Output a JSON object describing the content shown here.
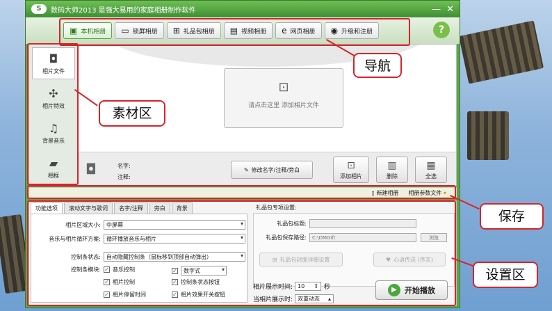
{
  "window": {
    "logo": "S",
    "title": "数码大师2013    是强大易用的家庭相册制作软件",
    "minimize": "—",
    "close": "✕"
  },
  "nav": {
    "tabs": [
      {
        "label": "本机相册",
        "icon": "photo-album-icon",
        "glyph": "▣"
      },
      {
        "label": "锁屏相册",
        "icon": "monitor-icon",
        "glyph": "▭"
      },
      {
        "label": "礼品包相册",
        "icon": "gift-icon",
        "glyph": "⊞"
      },
      {
        "label": "视频相册",
        "icon": "film-icon",
        "glyph": "▤"
      },
      {
        "label": "网页相册",
        "icon": "ie-icon",
        "glyph": "e"
      },
      {
        "label": "升级和注册",
        "icon": "globe-icon",
        "glyph": "◉"
      }
    ],
    "help": "?"
  },
  "leftbar": {
    "items": [
      {
        "label": "相片文件",
        "icon": "camera-icon",
        "glyph": "◘"
      },
      {
        "label": "相片特效",
        "icon": "effects-icon",
        "glyph": "✣"
      },
      {
        "label": "背景音乐",
        "icon": "music-icon",
        "glyph": "♫"
      },
      {
        "label": "相框",
        "icon": "frame-icon",
        "glyph": "▰"
      }
    ]
  },
  "canvas": {
    "drop_text": "请点击这里  添加相片文件",
    "drop_glyph": "⊡"
  },
  "info": {
    "name_label": "名字:",
    "note_label": "注释:",
    "edit_button": "修改名字/注释/旁白",
    "add_button": "添加相片",
    "delete_button": "删除",
    "selectall_button": "全选"
  },
  "savebar": {
    "new_album": "新建相册",
    "album_params": "相册参数文件"
  },
  "settings": {
    "tabs": [
      "功能选项",
      "滚动文字与歌词",
      "名字/注释",
      "旁白",
      "背景"
    ],
    "photo_size_label": "相片区域大小:",
    "photo_size_value": "中屏幕",
    "loop_label": "音乐与相片循环方案:",
    "loop_value": "循环播放音乐与相片",
    "ctrl_state_label": "控制条状态:",
    "ctrl_state_value": "自动隐藏控制条（鼠标移到顶部自动弹出）",
    "ctrl_module_label": "控制条模块:",
    "checks": [
      {
        "label": "音乐控制",
        "checked": true
      },
      {
        "label": "数字式",
        "checked": true,
        "is_select": true
      },
      {
        "label": "相片控制",
        "checked": true
      },
      {
        "label": "控制条状态按钮",
        "checked": true
      },
      {
        "label": "相片停留时间",
        "checked": true
      },
      {
        "label": "相片效果开关按钮",
        "checked": true
      }
    ]
  },
  "gift": {
    "header": "礼品包专项设置:",
    "title_label": "礼品包标题:",
    "title_value": "",
    "path_label": "礼品包保存路径:",
    "path_value": "C:\\DMGift",
    "browse": "浏览",
    "cover_button": "礼品包封面详细设置",
    "heart_button": "心语传送 (序言)",
    "show_time_label": "相片展示时间:",
    "show_time_value": "10",
    "show_time_unit": "秒",
    "show_mode_label": "当相片展示时:",
    "show_mode_value": "双重动态",
    "play_button": "开始播放"
  },
  "callouts": {
    "nav": "导航",
    "material": "素材区",
    "save": "保存",
    "settings": "设置区"
  },
  "colors": {
    "accent": "#5aa64a",
    "annotation": "#d8232a"
  }
}
